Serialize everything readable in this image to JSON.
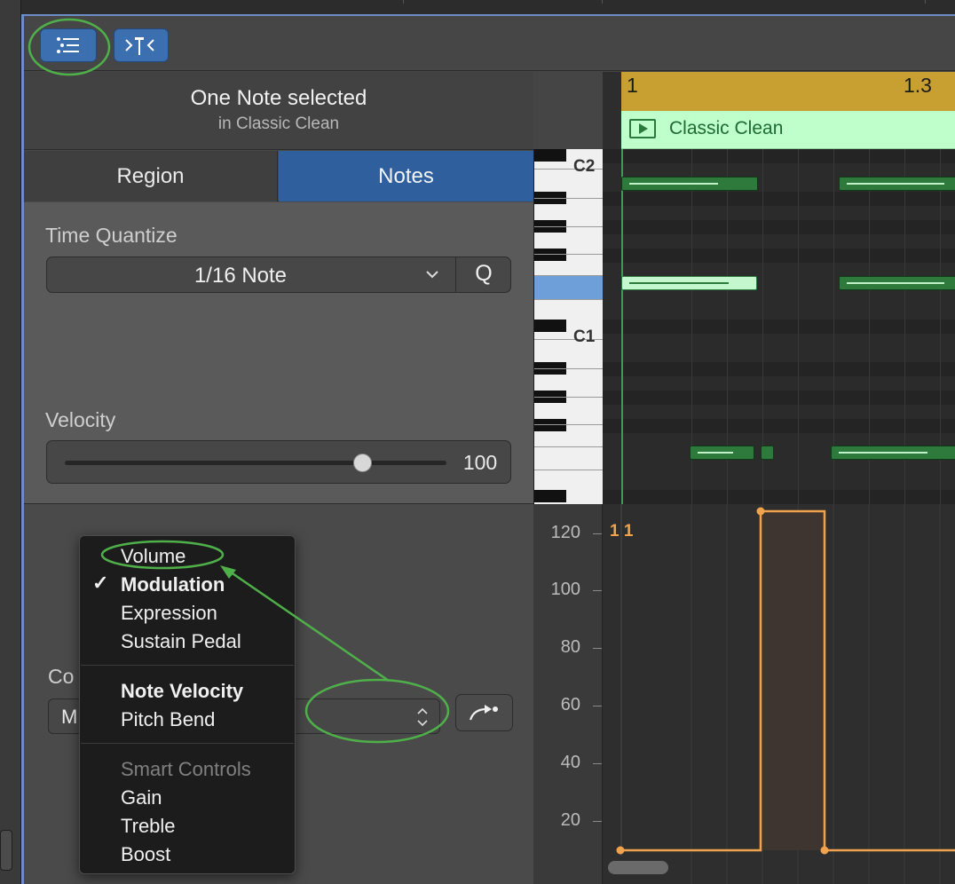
{
  "toolbar": {
    "inspector_icon": "inspector-list-icon",
    "catch_icon": "catch-playhead-icon"
  },
  "selection": {
    "title": "One Note selected",
    "subtitle": "in Classic Clean"
  },
  "tabs": [
    {
      "label": "Region",
      "active": false
    },
    {
      "label": "Notes",
      "active": true
    }
  ],
  "notes_inspector": {
    "time_quantize_label": "Time Quantize",
    "time_quantize_value": "1/16 Note",
    "quantize_button": "Q",
    "velocity_label": "Velocity",
    "velocity_value": "100",
    "velocity_fraction": 0.78
  },
  "controller": {
    "label": "Co",
    "select_value": "M",
    "action_icon": "arrow-forward-icon"
  },
  "menu": {
    "items": [
      {
        "label": "Volume",
        "checked": false,
        "bold": false,
        "enabled": true
      },
      {
        "label": "Modulation",
        "checked": true,
        "bold": true,
        "enabled": true
      },
      {
        "label": "Expression",
        "checked": false,
        "bold": false,
        "enabled": true
      },
      {
        "label": "Sustain Pedal",
        "checked": false,
        "bold": false,
        "enabled": true
      },
      {
        "label": "Note Velocity",
        "checked": false,
        "bold": true,
        "enabled": true
      },
      {
        "label": "Pitch Bend",
        "checked": false,
        "bold": false,
        "enabled": true
      },
      {
        "label": "Smart Controls",
        "checked": false,
        "bold": false,
        "enabled": false
      },
      {
        "label": "Gain",
        "checked": false,
        "bold": false,
        "enabled": true
      },
      {
        "label": "Treble",
        "checked": false,
        "bold": false,
        "enabled": true
      },
      {
        "label": "Boost",
        "checked": false,
        "bold": false,
        "enabled": true
      }
    ],
    "check_glyph": "✓"
  },
  "keyboard": {
    "labels": [
      "C2",
      "C1"
    ]
  },
  "ruler": {
    "bar_start": "1",
    "bar_marker": "1.3"
  },
  "region": {
    "name": "Classic Clean"
  },
  "automation": {
    "y_labels": [
      "120",
      "100",
      "80",
      "60",
      "40",
      "20"
    ],
    "position_label": "1 1",
    "line_color": "#f0a34c"
  },
  "colors": {
    "accent": "#2f5f9c",
    "region": "#bfffcc",
    "ruler": "#c8a032",
    "note": "#2e7a3d",
    "annotation": "#4fb04a"
  }
}
